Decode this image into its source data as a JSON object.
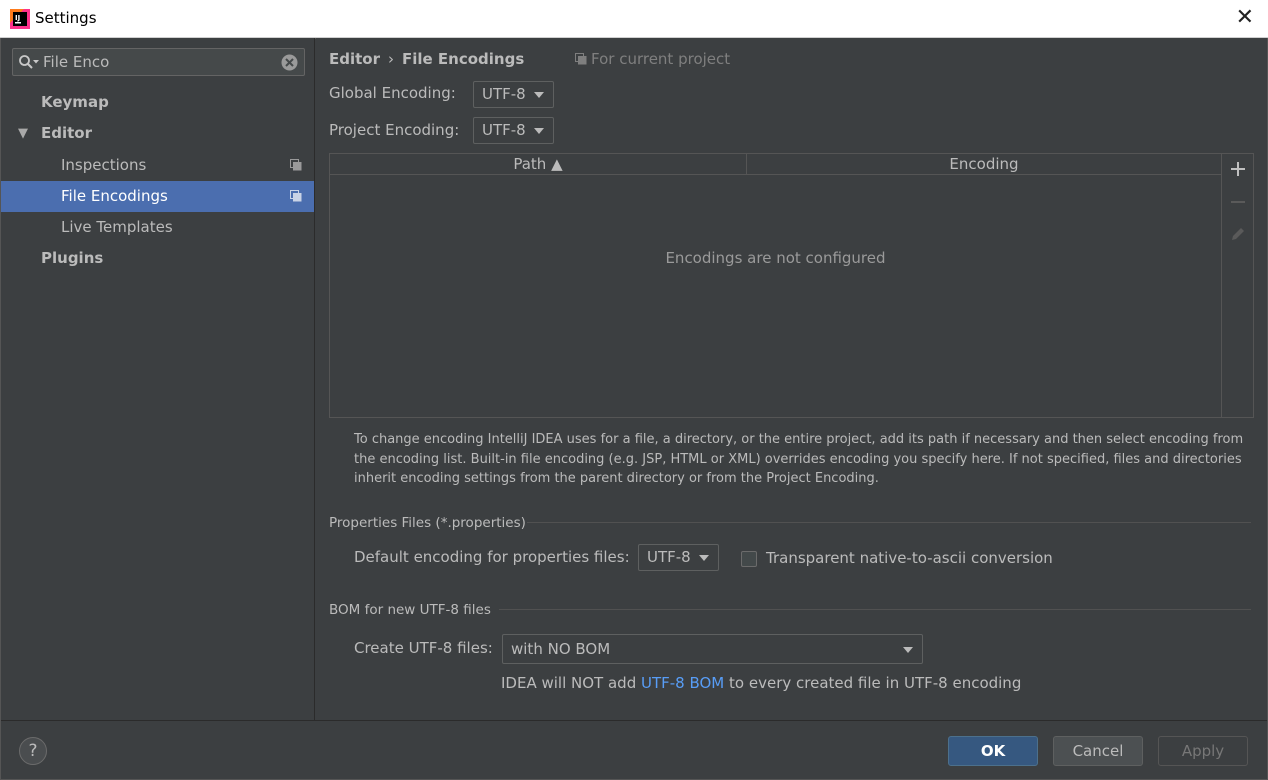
{
  "window": {
    "title": "Settings",
    "close_glyph": "✕"
  },
  "sidebar": {
    "search": {
      "value": "File Enco"
    },
    "items": [
      {
        "label": "Keymap"
      },
      {
        "label": "Editor"
      },
      {
        "label": "Inspections"
      },
      {
        "label": "File Encodings"
      },
      {
        "label": "Live Templates"
      },
      {
        "label": "Plugins"
      }
    ]
  },
  "main": {
    "breadcrumb": {
      "parent": "Editor",
      "separator": "›",
      "current": "File Encodings",
      "scope": "For current project"
    },
    "global_encoding": {
      "label": "Global Encoding:",
      "value": "UTF-8"
    },
    "project_encoding": {
      "label": "Project Encoding:",
      "value": "UTF-8"
    },
    "table": {
      "columns": [
        "Path ▲",
        "Encoding"
      ],
      "empty_text": "Encodings are not configured"
    },
    "description": "To change encoding IntelliJ IDEA uses for a file, a directory, or the entire project, add its path if necessary and then select encoding from the encoding list. Built-in file encoding (e.g. JSP, HTML or XML) overrides encoding you specify here. If not specified, files and directories inherit encoding settings from the parent directory or from the Project Encoding.",
    "properties": {
      "group_title": "Properties Files (*.properties)",
      "default_label": "Default encoding for properties files:",
      "default_value": "UTF-8",
      "transparent_label": "Transparent native-to-ascii conversion",
      "transparent_checked": false
    },
    "bom": {
      "group_title": "BOM for new UTF-8 files",
      "create_label": "Create UTF-8 files:",
      "create_value": "with NO BOM",
      "note_prefix": "IDEA will NOT add ",
      "note_link": "UTF-8 BOM",
      "note_suffix": " to every created file in UTF-8 encoding"
    }
  },
  "footer": {
    "help": "?",
    "ok": "OK",
    "cancel": "Cancel",
    "apply": "Apply"
  },
  "colors": {
    "selection": "#4b6eaf",
    "link": "#589df6",
    "primary_button": "#365880",
    "background": "#3c3f41"
  }
}
